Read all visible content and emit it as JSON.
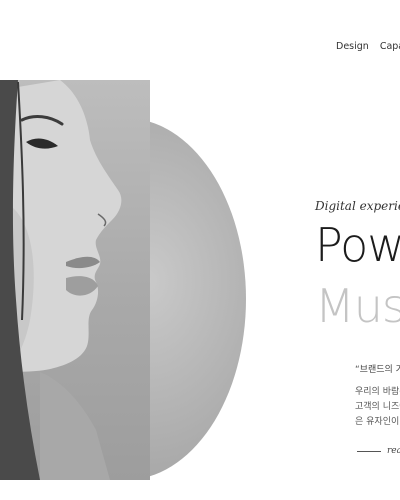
{
  "nav": {
    "items": [
      "Design",
      "Capabi"
    ]
  },
  "hero": {
    "tagline": "Digital experience d",
    "headline_line1": "Powe",
    "headline_line2": "Musi",
    "quote": "“브랜드의 가",
    "body_lines": [
      "우리의 바람은",
      "고객의 니즈에",
      "은 유자인이 인"
    ],
    "read_more": "reac"
  },
  "colors": {
    "headline_dark": "#1c1c1c",
    "headline_light": "#c4c4c4",
    "circle": "#b4b4b4"
  }
}
